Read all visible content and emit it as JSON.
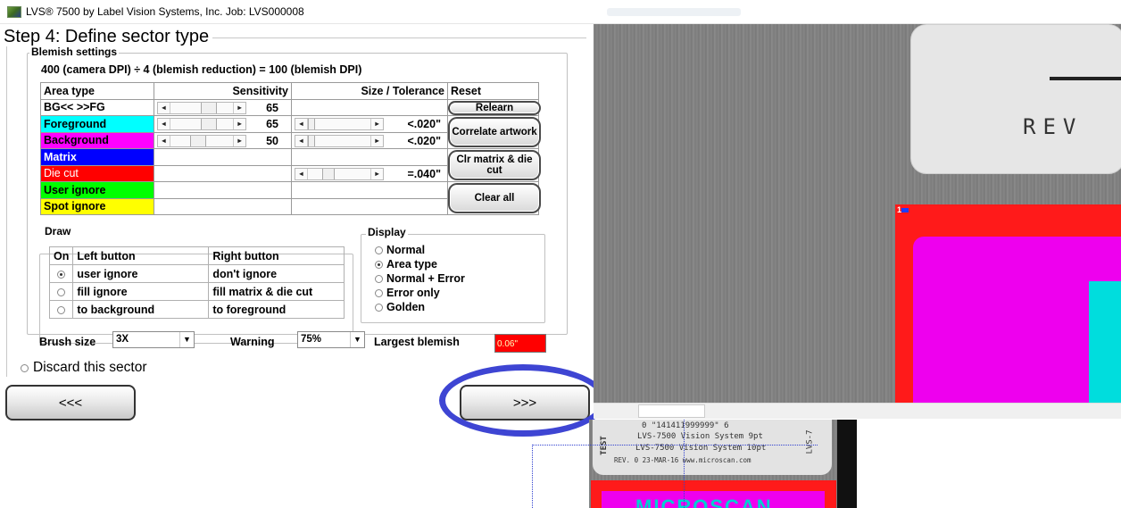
{
  "window": {
    "title": "LVS® 7500 by Label Vision Systems, Inc.  Job: LVS000008"
  },
  "step": {
    "title": "Step 4: Define sector type"
  },
  "blemish": {
    "group_label": "Blemish settings",
    "dpi_text": "400 (camera DPI) ÷ 4 (blemish reduction) = 100 (blemish DPI)",
    "headers": {
      "area_type": "Area type",
      "sensitivity": "Sensitivity",
      "size_tolerance": "Size / Tolerance",
      "reset": "Reset"
    },
    "rows": [
      {
        "name": "BG<< >>FG",
        "color": "#ffffff",
        "sensitivity": "65",
        "size": ""
      },
      {
        "name": "Foreground",
        "color": "#00ffff",
        "sensitivity": "65",
        "size": "<.020\""
      },
      {
        "name": "Background",
        "color": "#ff00ff",
        "sensitivity": "50",
        "size": "<.020\""
      },
      {
        "name": "Matrix",
        "color": "#0000ff",
        "sensitivity": "",
        "size": ""
      },
      {
        "name": "Die cut",
        "color": "#ff0000",
        "sensitivity": "",
        "size": "=.040\""
      },
      {
        "name": "User ignore",
        "color": "#00ff00",
        "sensitivity": "",
        "size": ""
      },
      {
        "name": "Spot ignore",
        "color": "#ffff00",
        "sensitivity": "",
        "size": ""
      }
    ],
    "buttons": {
      "relearn": "Relearn",
      "correlate": "Correlate artwork",
      "clr_matrix": "Clr matrix & die cut",
      "clear_all": "Clear all"
    }
  },
  "draw": {
    "group_label": "Draw",
    "headers": {
      "on": "On",
      "left": "Left button",
      "right": "Right button"
    },
    "rows": [
      {
        "selected": true,
        "left": "user ignore",
        "right": "don't ignore"
      },
      {
        "selected": false,
        "left": "fill ignore",
        "right": "fill matrix & die cut"
      },
      {
        "selected": false,
        "left": "to background",
        "right": "to foreground"
      }
    ]
  },
  "display": {
    "group_label": "Display",
    "options": [
      "Normal",
      "Area type",
      "Normal + Error",
      "Error only",
      "Golden"
    ],
    "selected": "Area type"
  },
  "controls": {
    "brush_label": "Brush size",
    "brush_value": "3X",
    "warning_label": "Warning",
    "warning_value": "75%",
    "largest_label": "Largest blemish",
    "largest_value": "0.06\"",
    "discard_label": "Discard this sector",
    "prev_label": "<<<",
    "next_label": ">>>"
  },
  "image": {
    "card_text": "REV",
    "sector_tag": "1",
    "bottom_lines": [
      "0 \"141411999999\" 6",
      "LVS-7500 Vision System 9pt",
      "LVS-7500 Vision System 10pt",
      "REV. 0 23-MAR-16    www.microscan.com"
    ],
    "bottom_brand": "MICROSCAN",
    "test_text": "TEST",
    "side_text": "LVS-7"
  }
}
